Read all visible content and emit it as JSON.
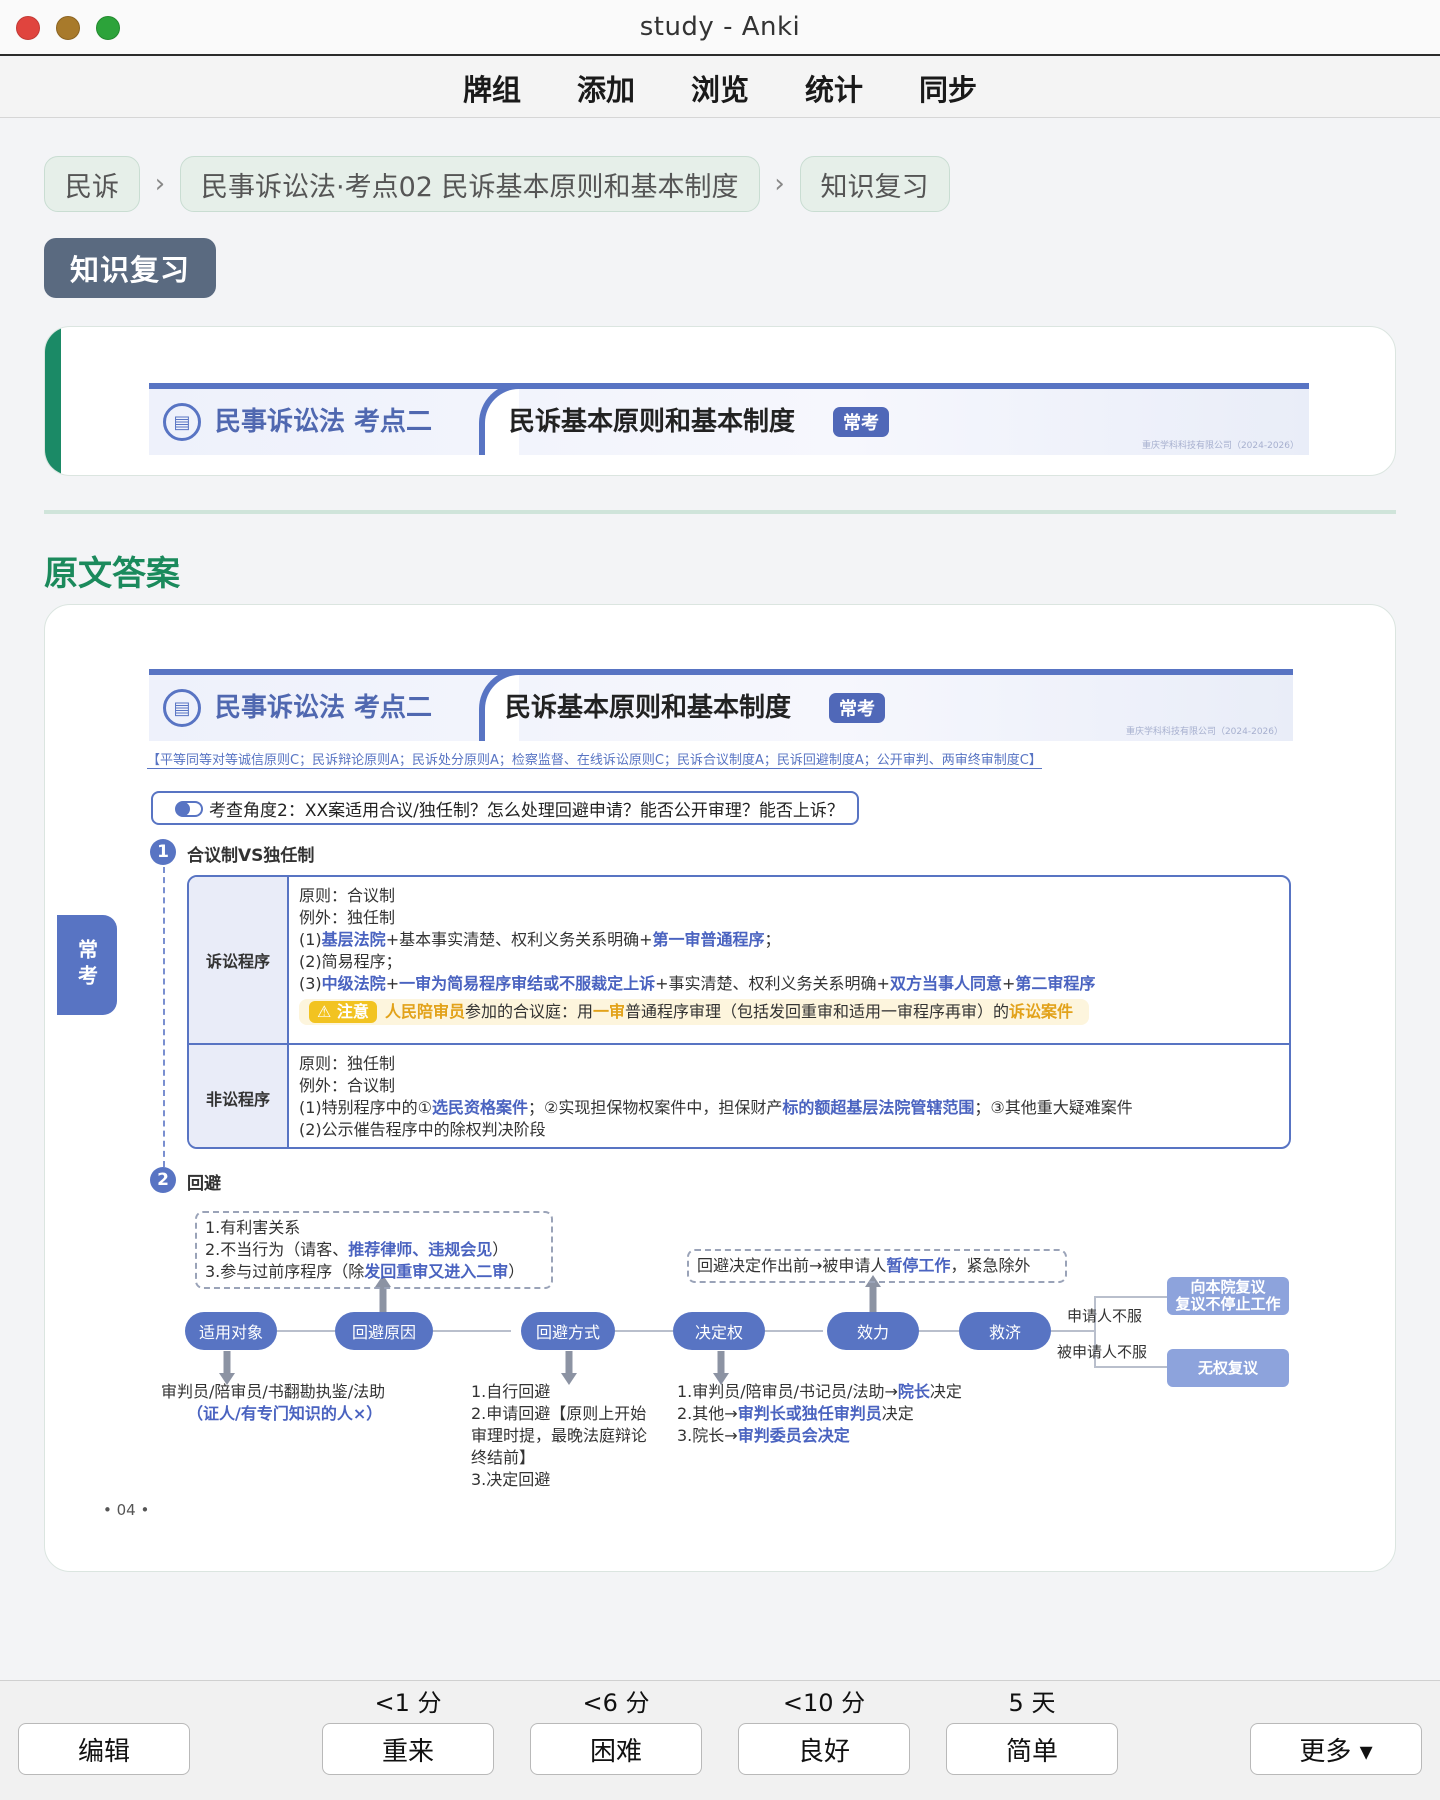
{
  "window": {
    "title": "study - Anki"
  },
  "toolbar": {
    "tabs": [
      "牌组",
      "添加",
      "浏览",
      "统计",
      "同步"
    ]
  },
  "breadcrumb": [
    "民诉",
    "民事诉讼法·考点02 民诉基本原则和基本制度",
    "知识复习"
  ],
  "badge": "知识复习",
  "banner": {
    "subject": "民事诉讼法 考点二",
    "title": "民诉基本原则和基本制度",
    "tag": "常考",
    "company": "重庆学科科技有限公司（2024-2026）"
  },
  "section_title": "原文答案",
  "answer": {
    "keywords": "【平等同等对等诚信原则C；民诉辩论原则A；民诉处分原则A；检察监督、在线诉讼原则C；民诉合议制度A；民诉回避制度A；公开审判、两审终审制度C】",
    "question": "考查角度2：XX案适用合议/独任制？怎么处理回避申请？能否公开审理？能否上诉？",
    "side_tag": "常考",
    "s1": {
      "num": "1",
      "title": "合议制VS独任制"
    },
    "table": {
      "r1_head": "诉讼程序",
      "r1_l1": "原则：合议制",
      "r1_l2": "例外：独任制",
      "r1_l3a": "(1)",
      "r1_l3b": "基层法院",
      "r1_l3c": "+基本事实清楚、权利义务关系明确+",
      "r1_l3d": "第一审普通程序",
      "r1_l3e": "；",
      "r1_l4": "(2)简易程序；",
      "r1_l5a": "(3)",
      "r1_l5b": "中级法院",
      "r1_l5c": "+",
      "r1_l5d": "一审为简易程序审结或不服裁定上诉",
      "r1_l5e": "+事实清楚、权利义务关系明确+",
      "r1_l5f": "双方当事人同意",
      "r1_l5g": "+",
      "r1_l5h": "第二审程序",
      "note_tag": "注意",
      "note_a": "人民陪审员",
      "note_b": "参加的合议庭：用",
      "note_c": "一审",
      "note_d": "普通程序审理（包括发回重审和适用一审程序再审）的",
      "note_e": "诉讼案件",
      "r2_head": "非讼程序",
      "r2_l1": "原则：独任制",
      "r2_l2": "例外：合议制",
      "r2_l3a": "(1)特别程序中的①",
      "r2_l3b": "选民资格案件",
      "r2_l3c": "；②实现担保物权案件中，担保财产",
      "r2_l3d": "标的额超基层法院管辖范围",
      "r2_l3e": "；③其他重大疑难案件",
      "r2_l4": "(2)公示催告程序中的除权判决阶段"
    },
    "s2": {
      "num": "2",
      "title": "回避"
    },
    "flow": {
      "nodes": [
        "适用对象",
        "回避原因",
        "回避方式",
        "决定权",
        "效力",
        "救济"
      ],
      "reasons_1": "1.有利害关系",
      "reasons_2a": "2.不当行为（请客、",
      "reasons_2b": "推荐律师、违规会见",
      "reasons_2c": "）",
      "reasons_3a": "3.参与过前序程序（除",
      "reasons_3b": "发回重审又进入二审",
      "reasons_3c": "）",
      "effect_a": "回避决定作出前→被申请人",
      "effect_b": "暂停工作",
      "effect_c": "，紧急除外",
      "applicants_1": "审判员/陪审员/书翻勘执鉴/法助",
      "applicants_2": "（证人/有专门知识的人×）",
      "method_1": "1.自行回避",
      "method_2": "2.申请回避【原则上开始",
      "method_3": "审理时提，最晚法庭辩论",
      "method_4": "终结前】",
      "method_5": "3.决定回避",
      "power_1a": "1.审判员/陪审员/书记员/法助→",
      "power_1b": "院长",
      "power_1c": "决定",
      "power_2a": "2.其他→",
      "power_2b": "审判长或独任审判员",
      "power_2c": "决定",
      "power_3a": "3.院长→",
      "power_3b": "审判委员会决定",
      "remedy_a_label": "申请人不服",
      "remedy_a_1": "向本院复议",
      "remedy_a_2": "复议不停止工作",
      "remedy_b_label": "被申请人不服",
      "remedy_b": "无权复议"
    },
    "page": "• 04 •"
  },
  "bottom": {
    "edit": "编辑",
    "answers": [
      {
        "interval": "<1 分",
        "label": "重来"
      },
      {
        "interval": "<6 分",
        "label": "困难"
      },
      {
        "interval": "<10 分",
        "label": "良好"
      },
      {
        "interval": "5 天",
        "label": "简单"
      }
    ],
    "more": "更多 ▾"
  }
}
